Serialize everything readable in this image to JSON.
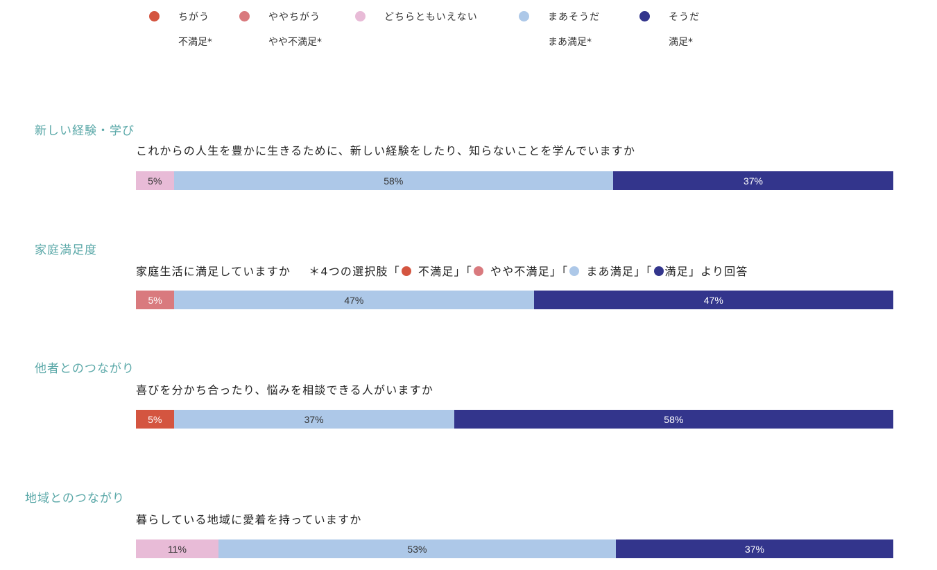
{
  "colors": {
    "chigau": "#d45540",
    "yaya_chigau": "#d97a7e",
    "dochiratomo": "#e8bbd7",
    "maa_souda": "#adc8e8",
    "souda": "#33358c",
    "section_title": "#5aa8a8"
  },
  "legend": [
    {
      "key": "chigau",
      "label": "ちがう",
      "sub": "不満足*",
      "color": "#d45540"
    },
    {
      "key": "yaya_chigau",
      "label": "ややちがう",
      "sub": "やや不満足*",
      "color": "#d97a7e"
    },
    {
      "key": "dochiratomo",
      "label": "どちらともいえない",
      "sub": "",
      "color": "#e8bbd7"
    },
    {
      "key": "maa_souda",
      "label": "まあそうだ",
      "sub": "まあ満足*",
      "color": "#adc8e8"
    },
    {
      "key": "souda",
      "label": "そうだ",
      "sub": "満足*",
      "color": "#33358c"
    }
  ],
  "sections": [
    {
      "title": "新しい経験・学び",
      "question": "これからの人生を豊かに生きるために、新しい経験をしたり、知らないことを学んでいますか"
    },
    {
      "title": "家庭満足度",
      "question": "家庭生活に満足していますか",
      "note_parts": [
        "＊4つの選択肢「",
        "不満足」「",
        "やや不満足」「",
        "まあ満足」「",
        "満足」より回答"
      ]
    },
    {
      "title": "他者とのつながり",
      "question": "喜びを分かち合ったり、悩みを相談できる人がいますか"
    },
    {
      "title": "地域とのつながり",
      "question": "暮らしている地域に愛着を持っていますか"
    }
  ],
  "chart_data": {
    "type": "bar",
    "orientation": "horizontal-stacked-100",
    "title": "",
    "xlabel": "",
    "ylabel": "",
    "xlim": [
      0,
      100
    ],
    "grid": false,
    "legend_position": "top",
    "categories": [
      "新しい経験・学び",
      "家庭満足度",
      "他者とのつながり",
      "地域とのつながり"
    ],
    "series": [
      {
        "name": "ちがう / 不満足",
        "color": "#d45540",
        "values": [
          0,
          0,
          5,
          0
        ],
        "labels": [
          "",
          "",
          "5%",
          ""
        ]
      },
      {
        "name": "ややちがう / やや不満足",
        "color": "#d97a7e",
        "values": [
          0,
          5,
          0,
          0
        ],
        "labels": [
          "",
          "5%",
          "",
          ""
        ]
      },
      {
        "name": "どちらともいえない",
        "color": "#e8bbd7",
        "values": [
          5,
          0,
          0,
          11
        ],
        "labels": [
          "5%",
          "",
          "",
          "11%"
        ]
      },
      {
        "name": "まあそうだ / まあ満足",
        "color": "#adc8e8",
        "values": [
          58,
          47,
          37,
          53
        ],
        "labels": [
          "58%",
          "47%",
          "37%",
          "53%"
        ]
      },
      {
        "name": "そうだ / 満足",
        "color": "#33358c",
        "values": [
          37,
          47,
          58,
          37
        ],
        "labels": [
          "37%",
          "47%",
          "58%",
          "37%"
        ]
      }
    ]
  }
}
